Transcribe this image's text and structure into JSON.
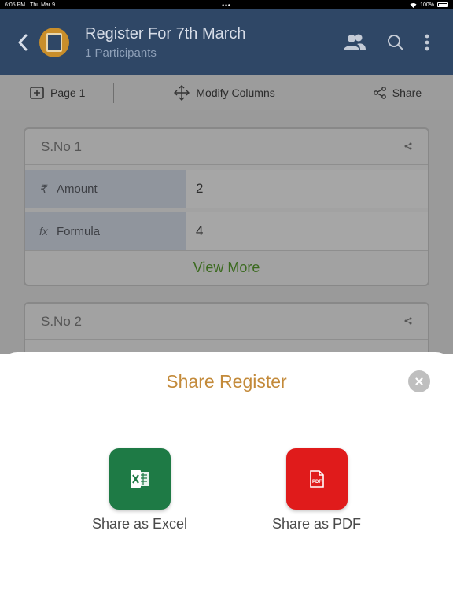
{
  "status_bar": {
    "time": "6:05 PM",
    "date": "Thu Mar 9",
    "dots": "•••",
    "battery": "100%"
  },
  "header": {
    "title": "Register For 7th March",
    "subtitle": "1 Participants",
    "icons": [
      "back-arrow-icon",
      "register-book-icon",
      "participants-icon",
      "search-icon",
      "more-vertical-icon"
    ],
    "background": "#2f4766"
  },
  "toolbar": {
    "page_label": "Page 1",
    "modify_label": "Modify Columns",
    "share_label": "Share"
  },
  "cards": [
    {
      "title": "S.No 1",
      "rows": [
        {
          "symbol": "₹",
          "label": "Amount",
          "value": "2"
        },
        {
          "symbol": "fx",
          "label": "Formula",
          "value": "4"
        }
      ],
      "view_more": "View More"
    },
    {
      "title": "S.No 2"
    }
  ],
  "sheet": {
    "title": "Share Register",
    "excel_label": "Share as Excel",
    "pdf_label": "Share as PDF",
    "pdf_badge": "PDF",
    "excel_color": "#1e7a45",
    "pdf_color": "#e01b1b",
    "title_color": "#c38a3a"
  }
}
